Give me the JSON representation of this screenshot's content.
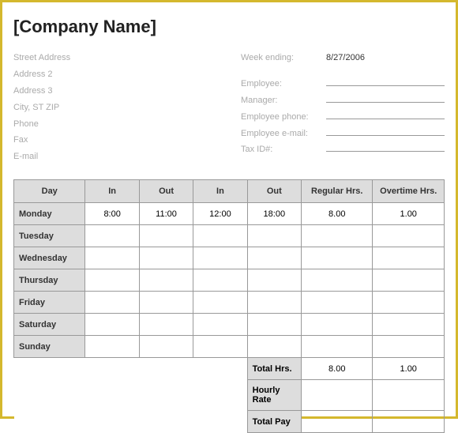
{
  "company": "[Company Name]",
  "address": {
    "street": "Street Address",
    "addr2": "Address 2",
    "addr3": "Address 3",
    "city": "City, ST  ZIP",
    "phone": "Phone",
    "fax": "Fax",
    "email": "E-mail"
  },
  "meta": {
    "week_ending_label": "Week ending:",
    "week_ending_value": "8/27/2006",
    "employee_label": "Employee:",
    "manager_label": "Manager:",
    "emp_phone_label": "Employee phone:",
    "emp_email_label": "Employee e-mail:",
    "tax_id_label": "Tax ID#:"
  },
  "headers": {
    "day": "Day",
    "in1": "In",
    "out1": "Out",
    "in2": "In",
    "out2": "Out",
    "reg": "Regular Hrs.",
    "ot": "Overtime Hrs."
  },
  "rows": {
    "mon": {
      "day": "Monday",
      "in1": "8:00",
      "out1": "11:00",
      "in2": "12:00",
      "out2": "18:00",
      "reg": "8.00",
      "ot": "1.00"
    },
    "tue": {
      "day": "Tuesday",
      "in1": "",
      "out1": "",
      "in2": "",
      "out2": "",
      "reg": "",
      "ot": ""
    },
    "wed": {
      "day": "Wednesday",
      "in1": "",
      "out1": "",
      "in2": "",
      "out2": "",
      "reg": "",
      "ot": ""
    },
    "thu": {
      "day": "Thursday",
      "in1": "",
      "out1": "",
      "in2": "",
      "out2": "",
      "reg": "",
      "ot": ""
    },
    "fri": {
      "day": "Friday",
      "in1": "",
      "out1": "",
      "in2": "",
      "out2": "",
      "reg": "",
      "ot": ""
    },
    "sat": {
      "day": "Saturday",
      "in1": "",
      "out1": "",
      "in2": "",
      "out2": "",
      "reg": "",
      "ot": ""
    },
    "sun": {
      "day": "Sunday",
      "in1": "",
      "out1": "",
      "in2": "",
      "out2": "",
      "reg": "",
      "ot": ""
    }
  },
  "totals": {
    "total_hrs_label": "Total Hrs.",
    "total_reg": "8.00",
    "total_ot": "1.00",
    "hourly_rate_label": "Hourly Rate",
    "total_pay_label": "Total Pay"
  }
}
